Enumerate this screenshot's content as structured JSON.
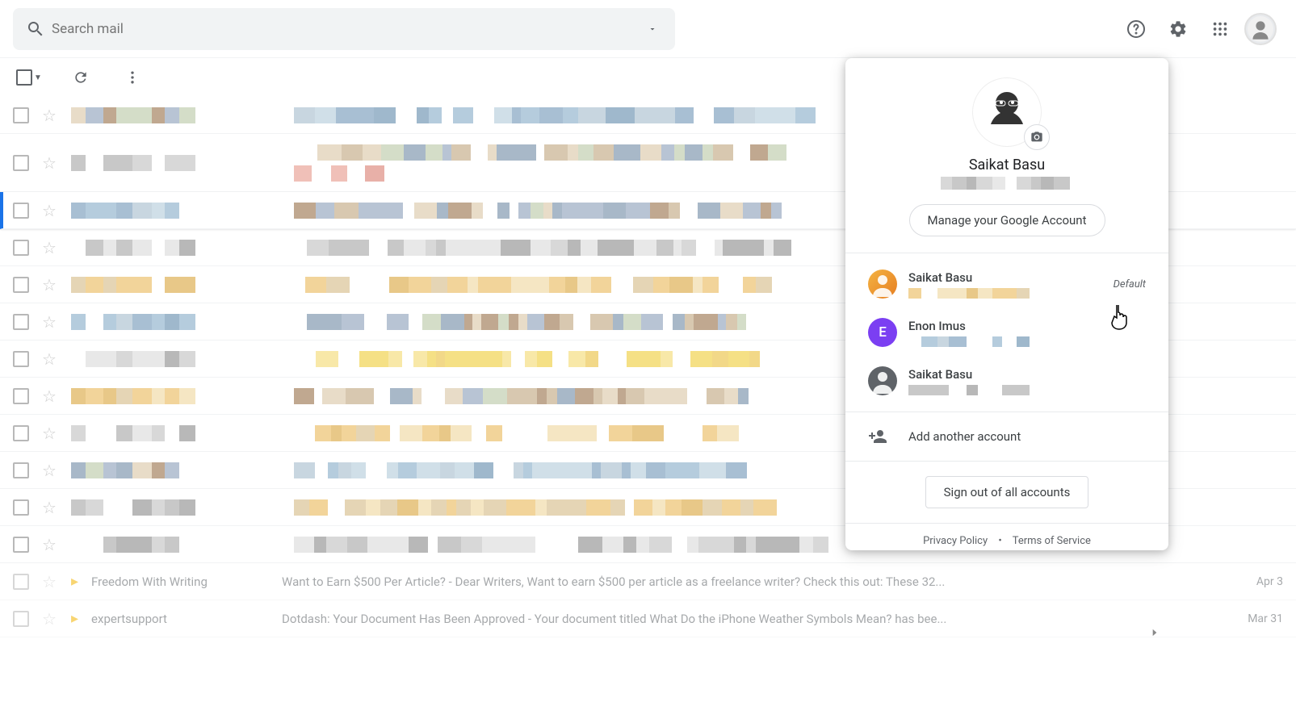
{
  "header": {
    "search_placeholder": "Search mail"
  },
  "account_popup": {
    "name": "Saikat Basu",
    "manage_label": "Manage your Google Account",
    "accounts": [
      {
        "name": "Saikat Basu",
        "initial": "",
        "bg": "av-orange",
        "default_label": "Default",
        "isDefault": true
      },
      {
        "name": "Enon Imus",
        "initial": "E",
        "bg": "av-purple",
        "default_label": "",
        "isDefault": false
      },
      {
        "name": "Saikat Basu",
        "initial": "",
        "bg": "av-gray",
        "default_label": "",
        "isDefault": false
      }
    ],
    "add_label": "Add another account",
    "signout_label": "Sign out of all accounts",
    "privacy": "Privacy Policy",
    "terms": "Terms of Service"
  },
  "visible_emails": [
    {
      "sender": "Freedom With Writing",
      "subject": "Want to Earn $500 Per Article? - Dear Writers, Want to earn $500 per article as a freelance writer? Check this out: These 32...",
      "date": "Apr 3"
    },
    {
      "sender": "expertsupport",
      "subject": "Dotdash: Your Document Has Been Approved - Your document titled What Do the iPhone Weather Symbols Mean? has bee...",
      "date": "Mar 31"
    }
  ],
  "pixel_palettes": {
    "warm": [
      "#f2d49a",
      "#e8c888",
      "#f5e6c3",
      "#ffffff",
      "#e5d5b5"
    ],
    "cool": [
      "#b5ccdd",
      "#9fb8cc",
      "#d0dfe8",
      "#ffffff",
      "#c8d6e0",
      "#a8bfd3"
    ],
    "mixed": [
      "#d4ddc8",
      "#c0a890",
      "#e8dcc8",
      "#b8c4d4",
      "#ffffff",
      "#d8c8b0",
      "#a8b8c8"
    ],
    "yellow": [
      "#f5e085",
      "#f8e8a8",
      "#ffffff",
      "#f2d888"
    ],
    "red": [
      "#e8b0a8",
      "#f0c0b8",
      "#ffffff"
    ],
    "gray": [
      "#d8d8d8",
      "#e8e8e8",
      "#c8c8c8",
      "#ffffff",
      "#b8b8b8"
    ]
  }
}
